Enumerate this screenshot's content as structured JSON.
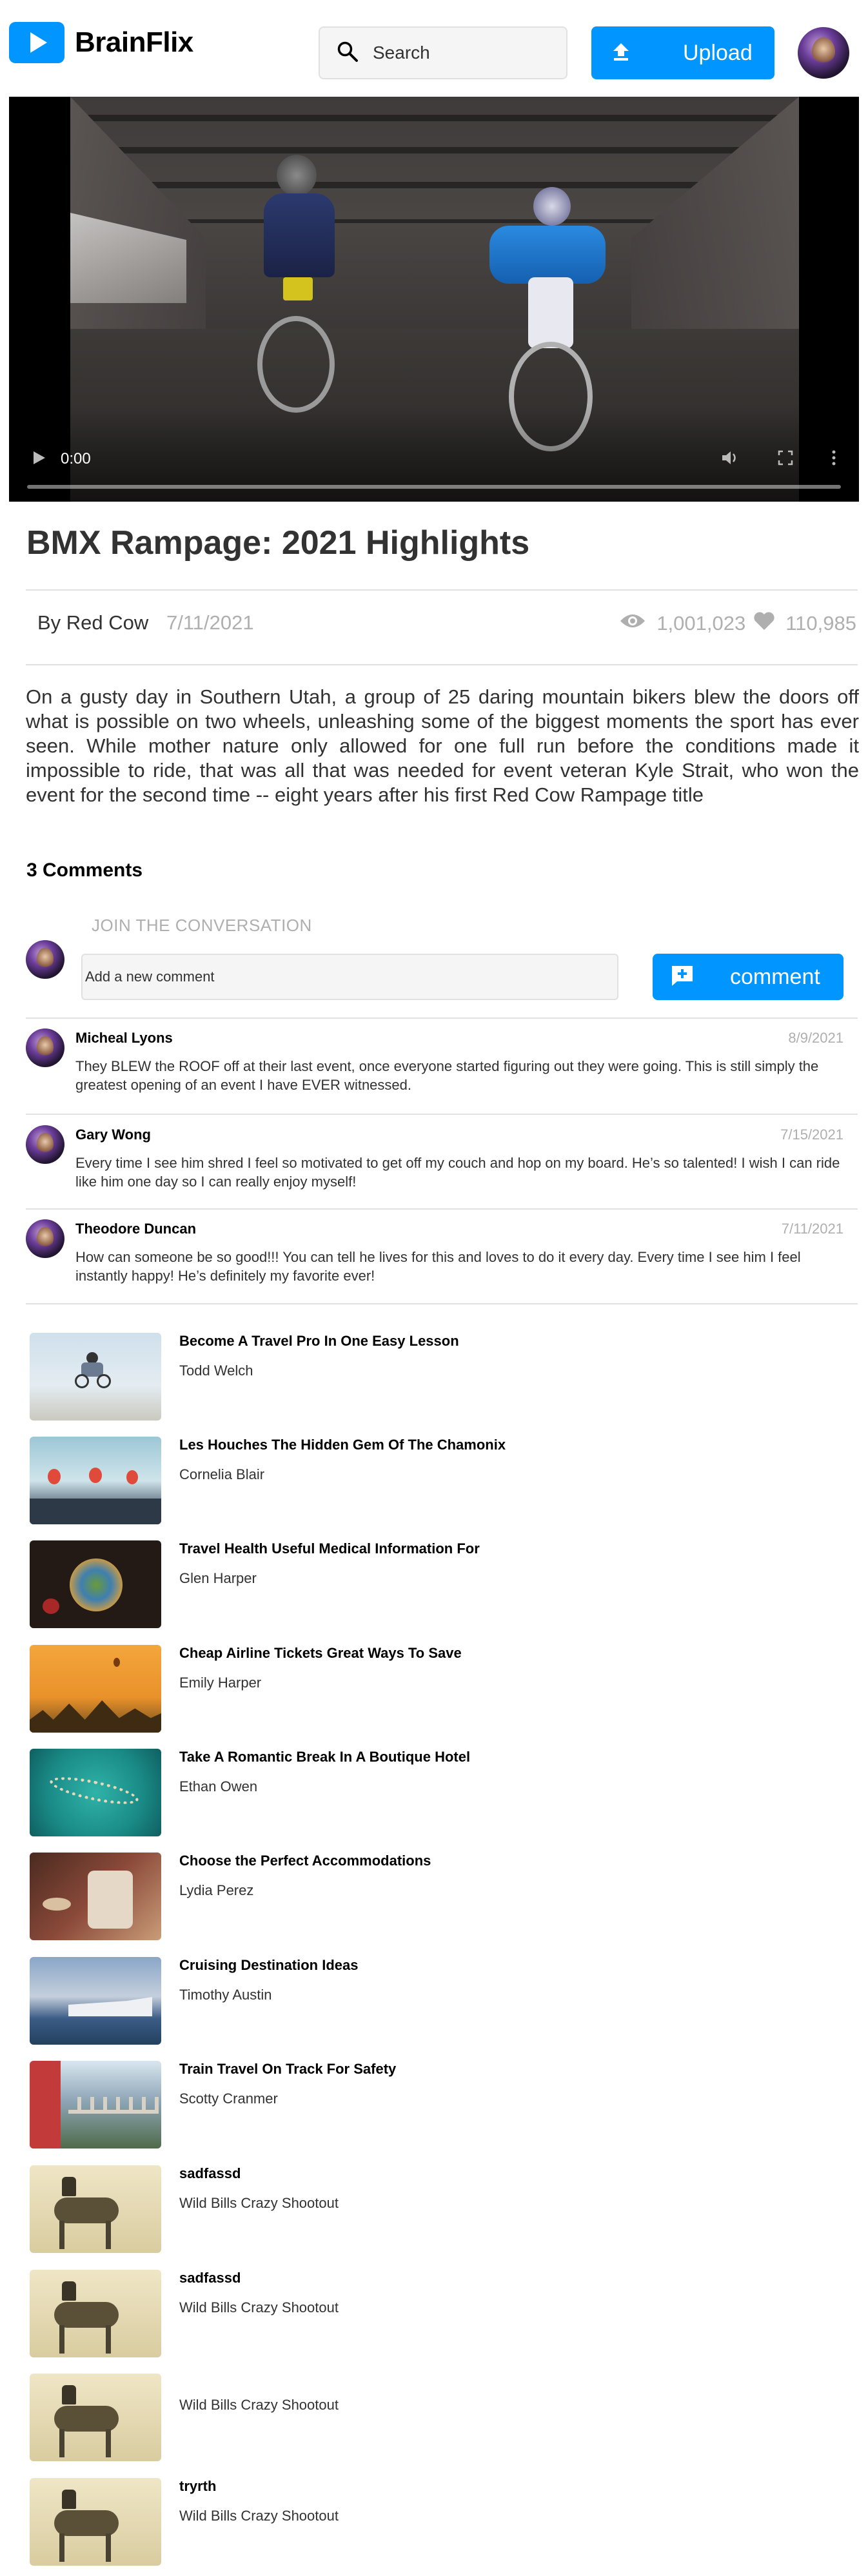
{
  "header": {
    "app_name": "BrainFlix",
    "search_placeholder": "Search",
    "upload_label": "Upload"
  },
  "video": {
    "time": "0:00",
    "title": "BMX Rampage: 2021 Highlights",
    "author": "By Red Cow",
    "date": "7/11/2021",
    "views": "1,001,023",
    "likes": "110,985",
    "description": "On a gusty day in Southern Utah, a group of 25 daring mountain bikers blew the doors off what is possible on two wheels, unleashing some of the biggest moments the sport has ever seen. While mother nature only allowed for one full run before the conditions made it impossible to ride, that was all that was needed for event veteran Kyle Strait, who won the event for the second time -- eight years after his first Red Cow Rampage title"
  },
  "comments": {
    "count_label": "3 Comments",
    "join_label": "JOIN THE CONVERSATION",
    "input_placeholder": "Add a new comment",
    "button_label": "comment",
    "items": [
      {
        "name": "Micheal Lyons",
        "date": "8/9/2021",
        "text": "They BLEW the ROOF off at their last event, once everyone started figuring out they were going. This is still simply the greatest opening of an event I have EVER witnessed."
      },
      {
        "name": "Gary Wong",
        "date": "7/15/2021",
        "text": "Every time I see him shred I feel so motivated to get off my couch and hop on my board. He’s so talented! I wish I can ride like him one day so I can really enjoy myself!"
      },
      {
        "name": "Theodore Duncan",
        "date": "7/11/2021",
        "text": "How can someone be so good!!! You can tell he lives for this and loves to do it every day. Every time I see him I feel instantly happy! He’s definitely my favorite ever!"
      }
    ]
  },
  "next_videos": [
    {
      "title": "Become A Travel Pro In One Easy Lesson",
      "author": "Todd Welch"
    },
    {
      "title": "Les Houches The Hidden Gem Of The Chamonix",
      "author": "Cornelia Blair"
    },
    {
      "title": "Travel Health Useful Medical Information For",
      "author": "Glen Harper"
    },
    {
      "title": "Cheap Airline Tickets Great Ways To Save",
      "author": "Emily Harper"
    },
    {
      "title": "Take A Romantic Break In A Boutique Hotel",
      "author": "Ethan Owen"
    },
    {
      "title": "Choose the Perfect Accommodations",
      "author": "Lydia Perez"
    },
    {
      "title": "Cruising Destination Ideas",
      "author": "Timothy Austin"
    },
    {
      "title": "Train Travel On Track For Safety",
      "author": "Scotty Cranmer"
    },
    {
      "title": "sadfassd",
      "author": "Wild Bills Crazy Shootout"
    },
    {
      "title": "sadfassd",
      "author": "Wild Bills Crazy Shootout"
    },
    {
      "title": "",
      "author": "Wild Bills Crazy Shootout"
    },
    {
      "title": "tryrth",
      "author": "Wild Bills Crazy Shootout"
    }
  ],
  "colors": {
    "brand_blue": "#0095ff",
    "text_dark": "#323232",
    "text_muted": "#afafaf",
    "divider": "#e1e1e1"
  }
}
